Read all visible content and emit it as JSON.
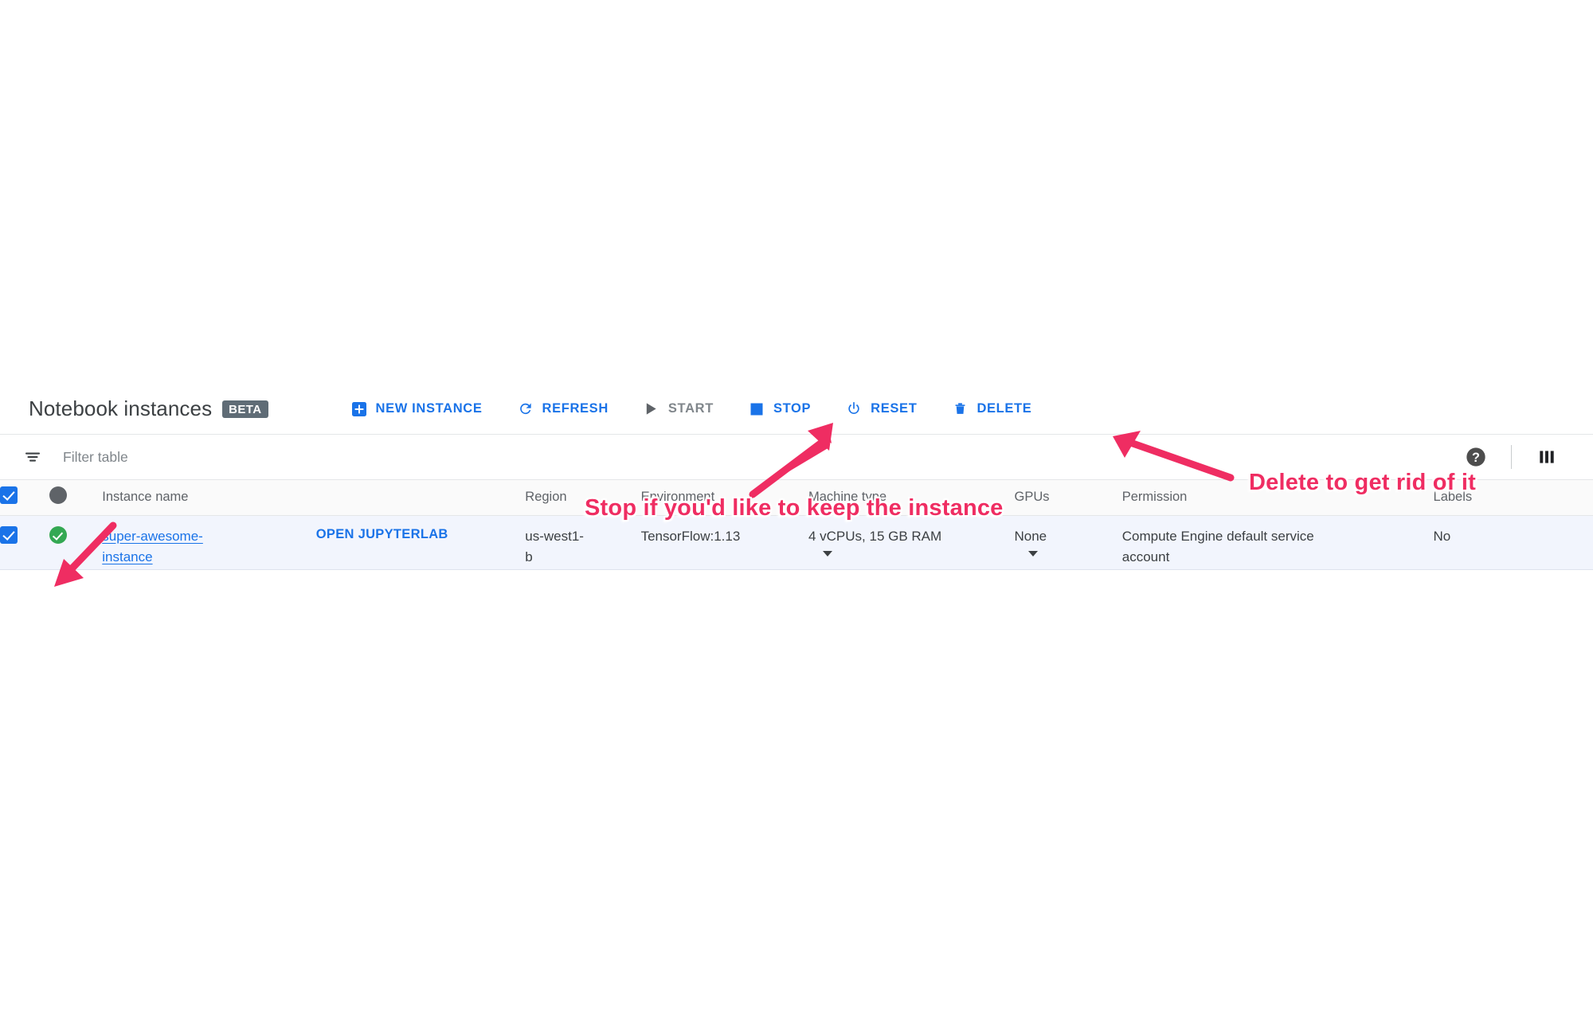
{
  "header": {
    "title": "Notebook instances",
    "badge": "BETA"
  },
  "toolbar": {
    "buttons": [
      {
        "label": "NEW INSTANCE",
        "icon": "plus-box-icon",
        "state": "enabled"
      },
      {
        "label": "REFRESH",
        "icon": "refresh-icon",
        "state": "enabled"
      },
      {
        "label": "START",
        "icon": "play-icon",
        "state": "disabled"
      },
      {
        "label": "STOP",
        "icon": "stop-square-icon",
        "state": "enabled"
      },
      {
        "label": "RESET",
        "icon": "power-icon",
        "state": "enabled"
      },
      {
        "label": "DELETE",
        "icon": "trash-icon",
        "state": "enabled"
      }
    ]
  },
  "filter_bar": {
    "icon": "filter-icon",
    "placeholder": "Filter table",
    "value": "",
    "help_icon": "help-circle-icon",
    "columns_icon": "column-settings-icon"
  },
  "table": {
    "columns": [
      "",
      "",
      "Instance name",
      "",
      "Region",
      "Environment",
      "Machine type",
      "GPUs",
      "Permission",
      "Labels"
    ],
    "headers": {
      "instance_name": "Instance name",
      "region": "Region",
      "environment": "Environment",
      "machine_type": "Machine type",
      "gpus": "GPUs",
      "permission": "Permission",
      "labels": "Labels"
    },
    "header_select_all_checked": true,
    "rows": [
      {
        "checked": true,
        "status": "healthy",
        "name_line1": "super-awesome-",
        "name_line2": "instance",
        "open_jupyterlab": "OPEN JUPYTERLAB",
        "region_line1": "us-west1-",
        "region_line2": "b",
        "environment": "TensorFlow:1.13",
        "machine_type": "4 vCPUs, 15 GB RAM",
        "gpus": "None",
        "permission_line1": "Compute Engine default service",
        "permission_line2": "account",
        "labels": "No"
      }
    ]
  },
  "annotations": [
    {
      "id": "stop",
      "text": "Stop if you'd like to keep the instance",
      "color": "#ef2d62"
    },
    {
      "id": "delete",
      "text": "Delete to get rid of it",
      "color": "#ef2d62"
    }
  ],
  "colors": {
    "accent_blue": "#1a73e8",
    "annotation_pink": "#ef2d62",
    "status_green": "#34a853",
    "badge_gray": "#5f6c76",
    "row_highlight": "#f2f5fd"
  }
}
